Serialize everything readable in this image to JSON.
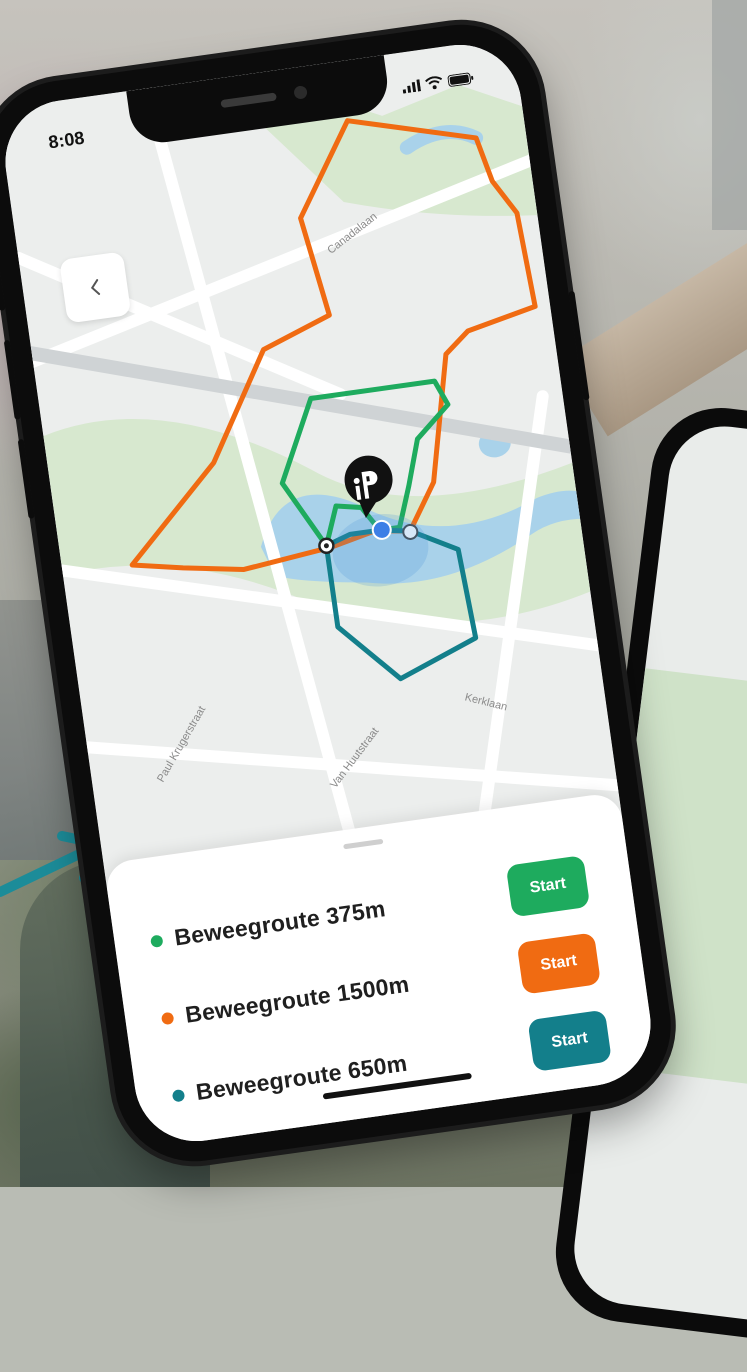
{
  "status": {
    "time": "8:08"
  },
  "map": {
    "streets": [
      "Canadalaan",
      "Paul Krugerstraat",
      "Van Huutstraat",
      "Kerklaan"
    ]
  },
  "routes": [
    {
      "label": "Beweegroute 375m",
      "color": "#1eab5e",
      "button": "Start"
    },
    {
      "label": "Beweegroute 1500m",
      "color": "#f06b12",
      "button": "Start"
    },
    {
      "label": "Beweegroute 650m",
      "color": "#137f8b",
      "button": "Start"
    }
  ],
  "colors": {
    "accent_teal": "#1c8c99",
    "water": "#a9d2ea",
    "park": "#d7e8cf"
  },
  "icons": [
    "back-chevron-icon",
    "signal-icon",
    "wifi-icon",
    "battery-icon",
    "ip-location-pin-icon",
    "arrow-icon"
  ]
}
